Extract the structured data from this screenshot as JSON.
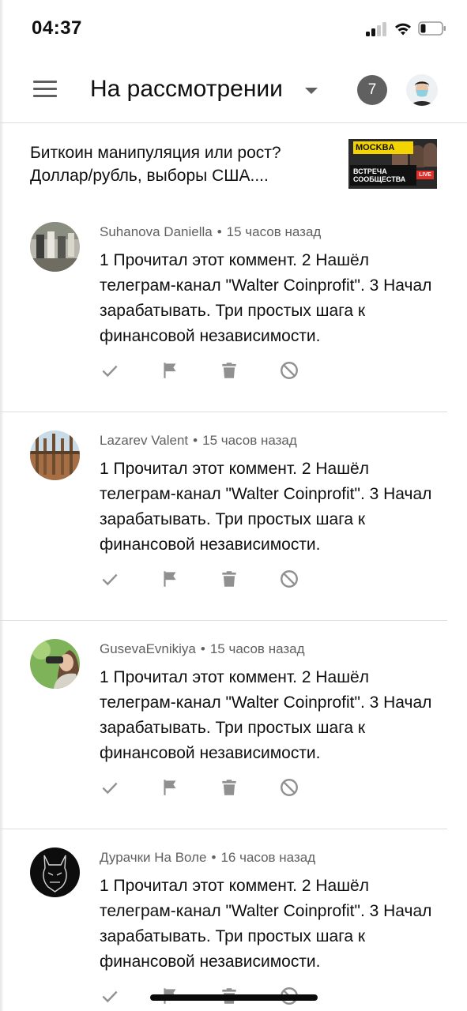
{
  "status_bar": {
    "time": "04:37"
  },
  "app_bar": {
    "title": "На рассмотрении",
    "count_badge": "7"
  },
  "video": {
    "title": "Биткоин манипуляция или рост? Доллар/рубль, выборы США....",
    "thumbnail": {
      "logo_text": "MOCKBA",
      "caption": "ВСТРЕЧА СООБЩЕСТВА",
      "live_label": "LIVE"
    }
  },
  "comments": [
    {
      "author": "Suhanova Daniella",
      "time": "15 часов назад",
      "text": "1 Прочитал этот коммент. 2 Нашёл телеграм-канал \"Walter Coinprofit\". 3 Начал зарабатывать. Три простых шага к финансовой независимости."
    },
    {
      "author": "Lazarev Valent",
      "time": "15 часов назад",
      "text": "1 Прочитал этот коммент. 2 Нашёл телеграм-канал \"Walter Coinprofit\". 3 Начал зарабатывать. Три простых шага к финансовой независимости."
    },
    {
      "author": "GusevaEvnikiya",
      "time": "15 часов назад",
      "text": "1 Прочитал этот коммент. 2 Нашёл телеграм-канал \"Walter Coinprofit\". 3 Начал зарабатывать. Три простых шага к финансовой независимости."
    },
    {
      "author": "Дурачки На Воле",
      "time": "16 часов назад",
      "text": "1 Прочитал этот коммент. 2 Нашёл телеграм-канал \"Walter Coinprofit\". 3 Начал зарабатывать. Три простых шага к финансовой независимости."
    }
  ],
  "action_icons": [
    "check-icon",
    "flag-icon",
    "trash-icon",
    "block-icon"
  ],
  "colors": {
    "icon_gray": "#909090",
    "text_primary": "#0f0f0f",
    "text_secondary": "#606060",
    "badge_bg": "#606060",
    "divider": "#dedede"
  },
  "meta_separator": "•"
}
